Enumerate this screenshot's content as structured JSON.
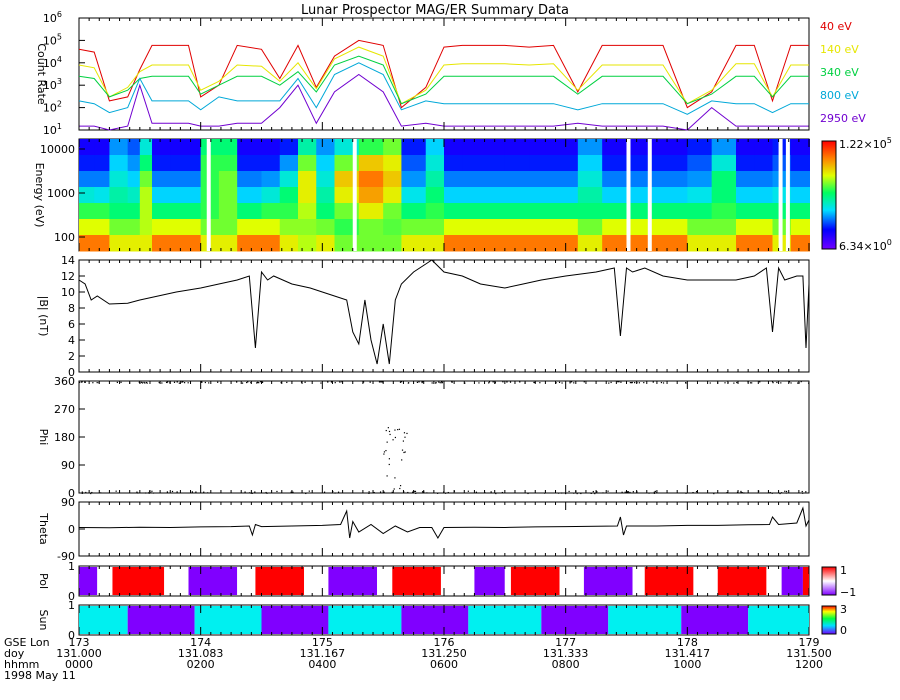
{
  "title": "Lunar Prospector MAG/ER Summary Data",
  "footer": {
    "row_labels": [
      "GSE Lon",
      "doy",
      "hhmm",
      "1998 May 11"
    ],
    "ticks": [
      {
        "lon": "173",
        "doy": "131.000",
        "hhmm": "0000"
      },
      {
        "lon": "174",
        "doy": "131.083",
        "hhmm": "0200"
      },
      {
        "lon": "175",
        "doy": "131.167",
        "hhmm": "0400"
      },
      {
        "lon": "176",
        "doy": "131.250",
        "hhmm": "0600"
      },
      {
        "lon": "177",
        "doy": "131.333",
        "hhmm": "0800"
      },
      {
        "lon": "178",
        "doy": "131.417",
        "hhmm": "1000"
      },
      {
        "lon": "179",
        "doy": "131.500",
        "hhmm": "1200"
      }
    ]
  },
  "colors": {
    "red": "#e00000",
    "yellow": "#e6e600",
    "green": "#00d040",
    "cyan": "#00a8d8",
    "purple": "#7000d0",
    "sun_cyan": "#00f0f0",
    "pol_red": "#ff0000",
    "pol_purple": "#8000ff"
  },
  "chart_data": [
    {
      "type": "line",
      "id": "count_rate",
      "ylabel": "Count Rate",
      "yscale": "log",
      "ylim": [
        10,
        1000000
      ],
      "ytick_labels": [
        {
          "base": "10",
          "exp": "1"
        },
        {
          "base": "10",
          "exp": "2"
        },
        {
          "base": "10",
          "exp": "3"
        },
        {
          "base": "10",
          "exp": "4"
        },
        {
          "base": "10",
          "exp": "5"
        },
        {
          "base": "10",
          "exp": "6"
        }
      ],
      "x": [
        0,
        0.25,
        0.5,
        0.8,
        1.0,
        1.2,
        1.5,
        1.8,
        2.0,
        2.3,
        2.6,
        3.0,
        3.3,
        3.6,
        3.9,
        4.2,
        4.6,
        5.0,
        5.3,
        5.7,
        6.0,
        6.3,
        6.6,
        7.0,
        7.4,
        7.8,
        8.2,
        8.6,
        9.0,
        9.3,
        9.6,
        10.0,
        10.4,
        10.8,
        11.1,
        11.4,
        11.7,
        12.0
      ],
      "series": [
        {
          "name": "40 eV",
          "color": "#e00000",
          "values": [
            40000,
            30000,
            200,
            300,
            5000,
            60000,
            60000,
            60000,
            300,
            1000,
            60000,
            40000,
            2000,
            60000,
            800,
            20000,
            100000,
            60000,
            100,
            800,
            50000,
            60000,
            60000,
            60000,
            50000,
            60000,
            500,
            60000,
            60000,
            60000,
            60000,
            100,
            500,
            60000,
            60000,
            200,
            60000,
            60000
          ]
        },
        {
          "name": "140 eV",
          "color": "#e6e600",
          "values": [
            8000,
            6000,
            300,
            800,
            4000,
            8000,
            8000,
            8000,
            600,
            1500,
            8000,
            7000,
            1500,
            10000,
            700,
            15000,
            50000,
            20000,
            150,
            600,
            8000,
            9000,
            9000,
            9000,
            8000,
            9000,
            600,
            8000,
            8000,
            8000,
            8000,
            150,
            600,
            9000,
            9000,
            300,
            8000,
            8000
          ]
        },
        {
          "name": "340 eV",
          "color": "#00d040",
          "values": [
            2500,
            2000,
            300,
            600,
            2000,
            2500,
            2500,
            2500,
            400,
            1000,
            2500,
            2500,
            1000,
            4000,
            500,
            8000,
            20000,
            8000,
            150,
            400,
            2500,
            2500,
            2500,
            2500,
            2500,
            2500,
            400,
            2500,
            2500,
            2500,
            2500,
            150,
            400,
            2500,
            2500,
            300,
            2500,
            2500
          ]
        },
        {
          "name": "800 eV",
          "color": "#00a8d8",
          "values": [
            200,
            150,
            60,
            100,
            2000,
            200,
            200,
            200,
            80,
            300,
            200,
            200,
            200,
            2000,
            100,
            3000,
            10000,
            3000,
            80,
            200,
            150,
            150,
            150,
            150,
            150,
            150,
            80,
            150,
            150,
            150,
            150,
            50,
            200,
            150,
            150,
            60,
            150,
            150
          ]
        },
        {
          "name": "2950 eV",
          "color": "#7000d0",
          "values": [
            15,
            15,
            10,
            15,
            1000,
            20,
            20,
            20,
            15,
            15,
            20,
            20,
            100,
            1000,
            20,
            500,
            3000,
            500,
            15,
            20,
            15,
            15,
            15,
            15,
            15,
            15,
            20,
            15,
            15,
            15,
            15,
            10,
            100,
            15,
            15,
            15,
            15,
            15
          ]
        }
      ]
    },
    {
      "type": "heatmap",
      "id": "energy_spectrogram",
      "ylabel": "Energy (eV)",
      "yscale": "log",
      "ytick_labels": [
        "10000",
        "1000",
        "100"
      ],
      "colorbar": {
        "max_base": "1.22×10",
        "max_exp": "5",
        "min_base": "6.34×10",
        "min_exp": "0"
      },
      "bands": [
        {
          "energy": 15000,
          "level": [
            0.15,
            0.15,
            0.3,
            0.25,
            0.4,
            0.15,
            0.15,
            0.15,
            0.5,
            0.5,
            0.15,
            0.15,
            0.2,
            0.45,
            0.3,
            0.4,
            0.55,
            0.6,
            0.2,
            0.35,
            0.15,
            0.15,
            0.15,
            0.15,
            0.15,
            0.15,
            0.3,
            0.15,
            0.15,
            0.15,
            0.15,
            0.2,
            0.3,
            0.15,
            0.15,
            0.2,
            0.15,
            0.15
          ]
        },
        {
          "energy": 5000,
          "level": [
            0.2,
            0.2,
            0.35,
            0.3,
            0.5,
            0.2,
            0.2,
            0.2,
            0.55,
            0.55,
            0.2,
            0.2,
            0.3,
            0.6,
            0.35,
            0.6,
            0.75,
            0.7,
            0.25,
            0.4,
            0.2,
            0.2,
            0.2,
            0.2,
            0.2,
            0.2,
            0.35,
            0.2,
            0.2,
            0.2,
            0.2,
            0.25,
            0.4,
            0.2,
            0.2,
            0.25,
            0.2,
            0.2
          ]
        },
        {
          "energy": 2000,
          "level": [
            0.28,
            0.28,
            0.4,
            0.35,
            0.6,
            0.28,
            0.28,
            0.28,
            0.55,
            0.6,
            0.28,
            0.3,
            0.4,
            0.7,
            0.4,
            0.75,
            0.85,
            0.75,
            0.3,
            0.45,
            0.28,
            0.28,
            0.28,
            0.28,
            0.28,
            0.28,
            0.4,
            0.28,
            0.28,
            0.28,
            0.28,
            0.3,
            0.5,
            0.28,
            0.28,
            0.3,
            0.28,
            0.28
          ]
        },
        {
          "energy": 900,
          "level": [
            0.4,
            0.38,
            0.45,
            0.42,
            0.65,
            0.35,
            0.35,
            0.35,
            0.55,
            0.6,
            0.35,
            0.4,
            0.5,
            0.7,
            0.45,
            0.7,
            0.8,
            0.7,
            0.38,
            0.5,
            0.35,
            0.35,
            0.35,
            0.35,
            0.35,
            0.35,
            0.45,
            0.35,
            0.35,
            0.35,
            0.35,
            0.38,
            0.5,
            0.35,
            0.35,
            0.38,
            0.35,
            0.35
          ]
        },
        {
          "energy": 400,
          "level": [
            0.55,
            0.55,
            0.5,
            0.5,
            0.65,
            0.5,
            0.5,
            0.5,
            0.55,
            0.6,
            0.5,
            0.55,
            0.55,
            0.65,
            0.5,
            0.6,
            0.7,
            0.6,
            0.5,
            0.55,
            0.5,
            0.5,
            0.5,
            0.5,
            0.5,
            0.5,
            0.5,
            0.5,
            0.5,
            0.5,
            0.5,
            0.5,
            0.55,
            0.5,
            0.5,
            0.5,
            0.5,
            0.5
          ]
        },
        {
          "energy": 150,
          "level": [
            0.68,
            0.68,
            0.6,
            0.6,
            0.65,
            0.68,
            0.68,
            0.68,
            0.6,
            0.6,
            0.68,
            0.68,
            0.62,
            0.62,
            0.6,
            0.55,
            0.6,
            0.58,
            0.6,
            0.6,
            0.68,
            0.68,
            0.68,
            0.68,
            0.68,
            0.68,
            0.6,
            0.68,
            0.68,
            0.68,
            0.68,
            0.6,
            0.6,
            0.68,
            0.68,
            0.6,
            0.68,
            0.68
          ]
        },
        {
          "energy": 60,
          "level": [
            0.85,
            0.85,
            0.7,
            0.7,
            0.7,
            0.85,
            0.85,
            0.85,
            0.7,
            0.7,
            0.85,
            0.85,
            0.7,
            0.65,
            0.7,
            0.6,
            0.6,
            0.6,
            0.7,
            0.7,
            0.85,
            0.85,
            0.85,
            0.85,
            0.85,
            0.85,
            0.7,
            0.85,
            0.85,
            0.85,
            0.85,
            0.7,
            0.7,
            0.85,
            0.85,
            0.7,
            0.85,
            0.85
          ]
        }
      ],
      "gaps_hours": [
        2.1,
        4.5,
        9.0,
        9.35,
        11.5,
        11.62
      ]
    },
    {
      "type": "line",
      "id": "b_magnitude",
      "ylabel": "|B| (nT)",
      "ylim": [
        0,
        14
      ],
      "ytick_labels": [
        "0",
        "2",
        "4",
        "6",
        "8",
        "10",
        "12",
        "14"
      ],
      "x": [
        0,
        0.1,
        0.2,
        0.3,
        0.5,
        0.8,
        1.0,
        1.3,
        1.6,
        2.0,
        2.3,
        2.6,
        2.8,
        2.9,
        3.0,
        3.1,
        3.2,
        3.5,
        3.8,
        4.0,
        4.2,
        4.4,
        4.5,
        4.6,
        4.7,
        4.8,
        4.9,
        5.0,
        5.1,
        5.2,
        5.3,
        5.5,
        5.7,
        5.8,
        6.0,
        6.3,
        6.6,
        7.0,
        7.3,
        7.6,
        8.0,
        8.5,
        8.8,
        8.9,
        9.0,
        9.1,
        9.3,
        9.6,
        10.0,
        10.4,
        10.8,
        11.1,
        11.3,
        11.4,
        11.5,
        11.6,
        11.8,
        11.9,
        11.95,
        12.0
      ],
      "values": [
        11.5,
        11,
        9,
        9.5,
        8.5,
        8.6,
        9,
        9.5,
        10,
        10.5,
        11,
        11.5,
        12,
        3,
        12.5,
        11.5,
        12,
        11,
        10.5,
        10,
        9.5,
        9,
        5,
        3.5,
        9,
        4,
        1,
        6,
        1,
        9,
        11,
        12.5,
        13.5,
        14,
        12.5,
        12,
        11,
        10.5,
        11,
        11.5,
        12,
        12.5,
        13,
        4.5,
        13,
        12.5,
        13,
        12,
        11.5,
        11.5,
        11.5,
        12,
        13,
        5,
        13,
        11.5,
        12,
        12,
        3,
        11
      ]
    },
    {
      "type": "scatter",
      "id": "phi",
      "ylabel": "Phi",
      "ylim": [
        0,
        360
      ],
      "ytick_labels": [
        "0",
        "90",
        "180",
        "270",
        "360"
      ]
    },
    {
      "type": "line",
      "id": "theta",
      "ylabel": "Theta",
      "ylim": [
        -90,
        90
      ],
      "ytick_labels": [
        "-90",
        "0",
        "90"
      ],
      "x": [
        0,
        0.5,
        1.0,
        1.5,
        2.0,
        2.5,
        2.8,
        2.85,
        2.9,
        3.0,
        3.5,
        4.0,
        4.3,
        4.4,
        4.45,
        4.5,
        4.6,
        4.8,
        5.0,
        5.2,
        5.4,
        5.6,
        5.8,
        5.9,
        6.0,
        6.5,
        7.0,
        7.5,
        8.0,
        8.5,
        8.85,
        8.9,
        8.95,
        9.0,
        9.5,
        10.0,
        10.5,
        11.0,
        11.35,
        11.4,
        11.5,
        11.8,
        11.9,
        11.95,
        12.0
      ],
      "values": [
        5,
        4,
        6,
        5,
        7,
        8,
        10,
        -20,
        15,
        8,
        10,
        12,
        15,
        60,
        -30,
        25,
        -10,
        15,
        -15,
        10,
        -10,
        5,
        5,
        -30,
        5,
        6,
        5,
        7,
        8,
        9,
        10,
        40,
        -20,
        10,
        10,
        12,
        12,
        14,
        15,
        40,
        15,
        20,
        70,
        10,
        30
      ]
    },
    {
      "type": "bar",
      "id": "polarity",
      "ylabel": "Pol",
      "ytick_labels": [
        "0",
        "1"
      ],
      "colorbar_labels": [
        "1",
        "−1"
      ],
      "segments": [
        {
          "start": 0,
          "end": 0.3,
          "color": "#8000ff"
        },
        {
          "start": 0.3,
          "end": 0.55,
          "color": "#ffffff"
        },
        {
          "start": 0.55,
          "end": 1.4,
          "color": "#ff0000"
        },
        {
          "start": 1.4,
          "end": 1.8,
          "color": "#ffffff"
        },
        {
          "start": 1.8,
          "end": 2.6,
          "color": "#8000ff"
        },
        {
          "start": 2.6,
          "end": 2.9,
          "color": "#ffffff"
        },
        {
          "start": 2.9,
          "end": 3.7,
          "color": "#ff0000"
        },
        {
          "start": 3.7,
          "end": 4.1,
          "color": "#ffffff"
        },
        {
          "start": 4.1,
          "end": 4.9,
          "color": "#8000ff"
        },
        {
          "start": 4.9,
          "end": 5.15,
          "color": "#ffffff"
        },
        {
          "start": 5.15,
          "end": 5.95,
          "color": "#ff0000"
        },
        {
          "start": 5.95,
          "end": 6.5,
          "color": "#ffffff"
        },
        {
          "start": 6.5,
          "end": 7.0,
          "color": "#8000ff"
        },
        {
          "start": 7.0,
          "end": 7.1,
          "color": "#ffffff"
        },
        {
          "start": 7.1,
          "end": 7.9,
          "color": "#ff0000"
        },
        {
          "start": 7.9,
          "end": 8.3,
          "color": "#ffffff"
        },
        {
          "start": 8.3,
          "end": 9.1,
          "color": "#8000ff"
        },
        {
          "start": 9.1,
          "end": 9.3,
          "color": "#ffffff"
        },
        {
          "start": 9.3,
          "end": 10.1,
          "color": "#ff0000"
        },
        {
          "start": 10.1,
          "end": 10.5,
          "color": "#ffffff"
        },
        {
          "start": 10.5,
          "end": 11.3,
          "color": "#ff0000"
        },
        {
          "start": 11.3,
          "end": 11.55,
          "color": "#ffffff"
        },
        {
          "start": 11.55,
          "end": 11.9,
          "color": "#8000ff"
        },
        {
          "start": 11.9,
          "end": 12.0,
          "color": "#ff0000"
        }
      ]
    },
    {
      "type": "bar",
      "id": "sun",
      "ylabel": "Sun",
      "ytick_labels": [
        "0",
        "1"
      ],
      "colorbar_labels": [
        "3",
        "0"
      ],
      "segments": [
        {
          "start": 0,
          "end": 0.8,
          "color": "#00f0f0"
        },
        {
          "start": 0.8,
          "end": 1.9,
          "color": "#8000ff"
        },
        {
          "start": 1.9,
          "end": 3.0,
          "color": "#00f0f0"
        },
        {
          "start": 3.0,
          "end": 4.1,
          "color": "#8000ff"
        },
        {
          "start": 4.1,
          "end": 5.3,
          "color": "#00f0f0"
        },
        {
          "start": 5.3,
          "end": 6.4,
          "color": "#8000ff"
        },
        {
          "start": 6.4,
          "end": 7.6,
          "color": "#00f0f0"
        },
        {
          "start": 7.6,
          "end": 8.7,
          "color": "#8000ff"
        },
        {
          "start": 8.7,
          "end": 9.9,
          "color": "#00f0f0"
        },
        {
          "start": 9.9,
          "end": 11.0,
          "color": "#8000ff"
        },
        {
          "start": 11.0,
          "end": 12.0,
          "color": "#00f0f0"
        }
      ]
    }
  ]
}
